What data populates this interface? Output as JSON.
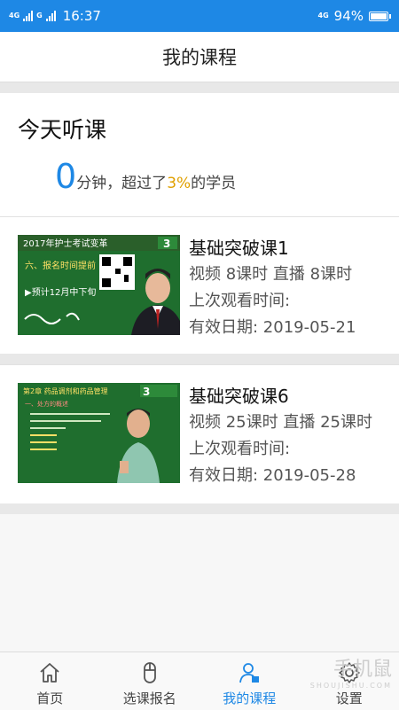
{
  "status": {
    "network_left": "4G",
    "network_left_2": "G",
    "time": "16:37",
    "network_right": "4G",
    "battery": "94%"
  },
  "header": {
    "title": "我的课程"
  },
  "today": {
    "heading": "今天听课",
    "minutes": "0",
    "minutes_suffix": "分钟，超过了",
    "percent": "3%",
    "percent_suffix": "的学员"
  },
  "courses": [
    {
      "title": "基础突破课1",
      "meta": "视频 8课时  直播 8课时",
      "last_watch": "上次观看时间:",
      "valid": "有效日期: 2019-05-21",
      "thumb": {
        "headline": "2017年护士考试变革",
        "line1": "六、报名时间提前",
        "line2": "▶预计12月中下旬",
        "logo": "3"
      }
    },
    {
      "title": "基础突破课6",
      "meta": "视频 25课时  直播 25课时",
      "last_watch": "上次观看时间:",
      "valid": "有效日期: 2019-05-28",
      "thumb": {
        "headline": "第2章  药品调剂和药品管理",
        "line1": "一、处方的概述",
        "line2": "",
        "logo": "3"
      }
    }
  ],
  "tabs": [
    {
      "label": "首页",
      "icon": "home-icon"
    },
    {
      "label": "选课报名",
      "icon": "mouse-icon"
    },
    {
      "label": "我的课程",
      "icon": "user-course-icon"
    },
    {
      "label": "设置",
      "icon": "gear-icon"
    }
  ],
  "watermark": {
    "text": "手机鼠",
    "sub": "SHOUJISHU.COM"
  },
  "colors": {
    "accent": "#1e88e5",
    "percent": "#e0a000",
    "board": "#1f6e2e"
  }
}
